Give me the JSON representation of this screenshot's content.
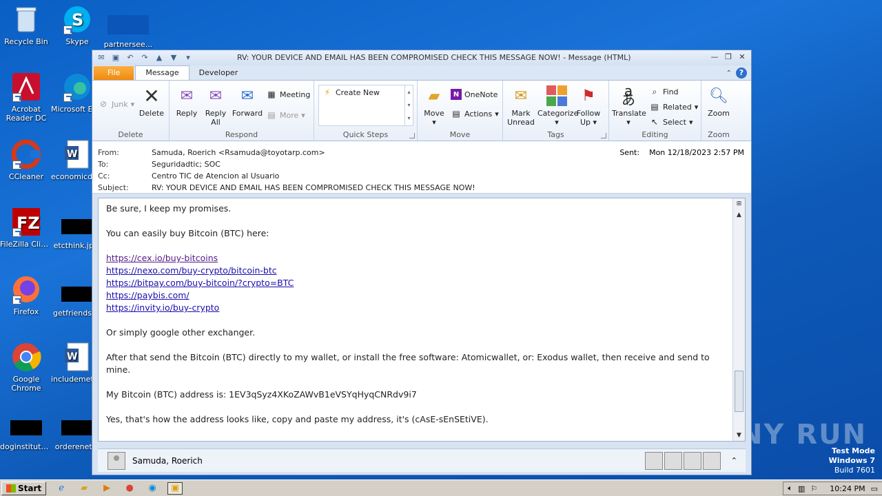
{
  "desktop": {
    "icons": [
      {
        "label": "Recycle Bin"
      },
      {
        "label": "Skype"
      },
      {
        "label": "partnersee..."
      },
      {
        "label": "Acrobat Reader DC"
      },
      {
        "label": "Microsoft Ed..."
      },
      {
        "label": "CCleaner"
      },
      {
        "label": "economicdv..."
      },
      {
        "label": "FileZilla Client"
      },
      {
        "label": "etcthink.jp..."
      },
      {
        "label": "Firefox"
      },
      {
        "label": "getfriends...."
      },
      {
        "label": "Google Chrome"
      },
      {
        "label": "includemeth..."
      },
      {
        "label": "doginstitute...."
      },
      {
        "label": "orderenet..."
      }
    ]
  },
  "window": {
    "title": "RV: YOUR DEVICE AND EMAIL HAS BEEN COMPROMISED CHECK THIS MESSAGE NOW! - Message (HTML)"
  },
  "tabs": [
    {
      "label": "File"
    },
    {
      "label": "Message"
    },
    {
      "label": "Developer"
    }
  ],
  "ribbon": {
    "delete_group": {
      "label": "Delete",
      "junk": "Junk",
      "delete": "Delete"
    },
    "respond_group": {
      "label": "Respond",
      "reply": "Reply",
      "reply_all_1": "Reply",
      "reply_all_2": "All",
      "forward": "Forward",
      "meeting": "Meeting",
      "more": "More"
    },
    "quick_steps_group": {
      "label": "Quick Steps",
      "create_new": "Create New"
    },
    "move_group": {
      "label": "Move",
      "move": "Move",
      "onenote": "OneNote",
      "actions": "Actions"
    },
    "tags_group": {
      "label": "Tags",
      "mark_unread_1": "Mark",
      "mark_unread_2": "Unread",
      "categorize": "Categorize",
      "follow_up_1": "Follow",
      "follow_up_2": "Up"
    },
    "editing_group": {
      "label": "Editing",
      "translate": "Translate",
      "find": "Find",
      "related": "Related",
      "select": "Select"
    },
    "zoom_group": {
      "label": "Zoom",
      "zoom": "Zoom"
    }
  },
  "header": {
    "from_label": "From:",
    "from_value": "Samuda, Roerich <Rsamuda@toyotarp.com>",
    "to_label": "To:",
    "to_value": "Seguridadtic; SOC",
    "cc_label": "Cc:",
    "cc_value": "Centro TIC de Atencion al Usuario",
    "subject_label": "Subject:",
    "subject_value": "RV: YOUR DEVICE AND EMAIL HAS BEEN COMPROMISED CHECK THIS MESSAGE NOW!",
    "sent_label": "Sent:",
    "sent_value": "Mon 12/18/2023 2:57 PM"
  },
  "message": {
    "line1": "Be sure, I keep my promises.",
    "line2": "You can easily buy Bitcoin (BTC) here:",
    "links": [
      "https://cex.io/buy-bitcoins",
      "https://nexo.com/buy-crypto/bitcoin-btc",
      "https://bitpay.com/buy-bitcoin/?crypto=BTC",
      "https://paybis.com/",
      "https://invity.io/buy-crypto"
    ],
    "line3": "Or simply google other exchanger.",
    "line4": "After that send the Bitcoin (BTC) directly to my wallet, or install the free software: Atomicwallet, or: Exodus wallet, then receive and send to mine.",
    "line5": "My Bitcoin (BTC) address is: 1EV3qSyz4XKoZAWvB1eVSYqHyqCNRdv9i7",
    "line6": "Yes, that's how the address looks like, copy and paste my address, it's (cAsE-sEnSEtiVE)."
  },
  "people_pane": {
    "name": "Samuda, Roerich"
  },
  "taskbar": {
    "start": "Start",
    "time": "10:24 PM"
  },
  "watermark": {
    "line1": "Test Mode",
    "line2": "Windows 7",
    "line3": "Build 7601",
    "brand": "ANY RUN"
  }
}
